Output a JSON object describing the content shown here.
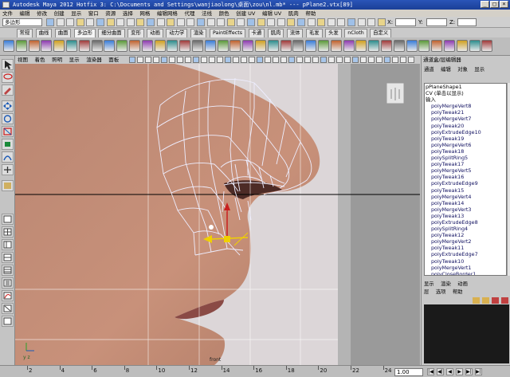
{
  "window": {
    "title": "Autodesk Maya 2012 Hotfix 3: C:\\Documents and Settings\\wanjiaolong\\桌面\\zou\\nl.mb*    ---    pPlane2.vtx[89]",
    "controls": [
      "_",
      "□",
      "×"
    ]
  },
  "menubar": [
    "文件",
    "编辑",
    "修改",
    "创建",
    "显示",
    "窗口",
    "资源",
    "选择",
    "网格",
    "编辑网格",
    "代理",
    "法线",
    "颜色",
    "创建 UV",
    "编辑 UV",
    "肌肉",
    "帮助"
  ],
  "statusline": {
    "mode_select": "多边形",
    "coord_labels": [
      "X:",
      "Y:",
      "Z:"
    ]
  },
  "shelf_tabs": [
    "常规",
    "曲线",
    "曲面",
    "多边形",
    "细分曲面",
    "变形",
    "动画",
    "动力学",
    "渲染",
    "PaintEffects",
    "卡通",
    "肌肉",
    "流体",
    "毛发",
    "头发",
    "nCloth",
    "自定义"
  ],
  "shelf_icons": [
    "sphere",
    "cube",
    "cylinder",
    "cone",
    "plane",
    "torus",
    "prism",
    "pyramid",
    "pipe",
    "helix",
    "soccer",
    "platonic",
    "combine",
    "separate",
    "extract",
    "smooth",
    "booleans",
    "mirror",
    "bevel",
    "bridge",
    "extrude",
    "append",
    "split",
    "insert-loop",
    "offset-loop",
    "merge",
    "target-weld",
    "uv-editor",
    "checker",
    "sculpt",
    "lattice",
    "cluster",
    "joint",
    "ik",
    "paint-weights",
    "render",
    "ipr",
    "render-settings",
    "hypershade"
  ],
  "viewport_menu": [
    "视图",
    "着色",
    "照明",
    "显示",
    "渲染器",
    "面板"
  ],
  "viewport": {
    "camera_label": "front",
    "axis_label": "y z",
    "reference": "side-profile nose photo"
  },
  "channel_box": {
    "header": "通道盒/层编辑器",
    "menu": [
      "通道",
      "编辑",
      "对象",
      "显示"
    ],
    "object": "pPlaneShape1",
    "section": "CV (单击以显示)",
    "inputs_label": "输入",
    "history": [
      "polyMergeVert8",
      "polyTweak21",
      "polyMergeVert7",
      "polyTweak20",
      "polyExtrudeEdge10",
      "polyTweak19",
      "polyMergeVert6",
      "polyTweak18",
      "polySplitRing5",
      "polyTweak17",
      "polyMergeVert5",
      "polyTweak16",
      "polyExtrudeEdge9",
      "polyTweak15",
      "polyMergeVert4",
      "polyTweak14",
      "polyMergeVert3",
      "polyTweak13",
      "polyExtrudeEdge8",
      "polySplitRing4",
      "polyTweak12",
      "polyMergeVert2",
      "polyTweak11",
      "polyExtrudeEdge7",
      "polyTweak10",
      "polyMergeVert1",
      "polyCloseBorder1"
    ]
  },
  "layer_editor": {
    "tabs": [
      "显示",
      "渲染",
      "动画"
    ],
    "menu": [
      "层",
      "选项",
      "帮助"
    ]
  },
  "timeline": {
    "ticks": [
      "2",
      "4",
      "6",
      "8",
      "10",
      "12",
      "14",
      "16",
      "18",
      "20",
      "22",
      "24"
    ],
    "current_frame": "1.00",
    "playback": [
      "|◀",
      "◀|",
      "◀",
      "▶",
      "▶|",
      "▶|"
    ]
  },
  "colors": {
    "titlebar": "#2a55b8",
    "ui_gray": "#c8c8c8",
    "skin": "#c79078",
    "wire": "#e8e8ff",
    "manip_yellow": "#f0d000",
    "layer_bg": "#1a1a1a"
  }
}
